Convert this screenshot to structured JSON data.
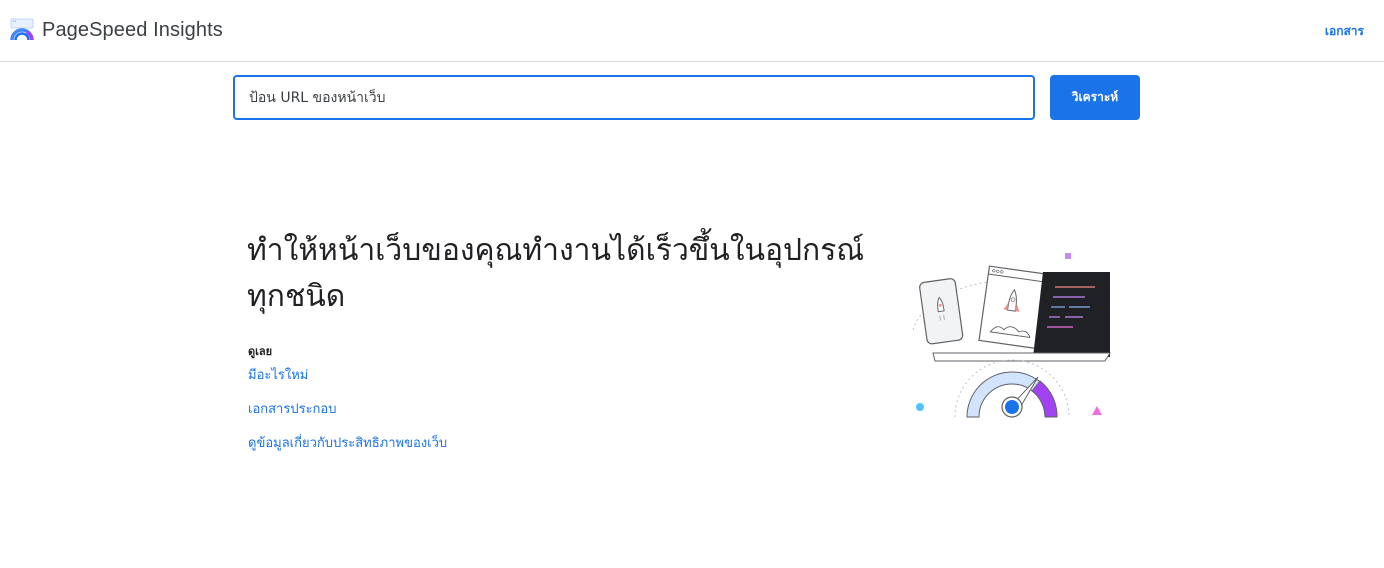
{
  "header": {
    "app_name": "PageSpeed Insights",
    "docs_link": "เอกสาร"
  },
  "search": {
    "placeholder": "ป้อน URL ของหน้าเว็บ",
    "value": "",
    "analyze_label": "วิเคราะห์"
  },
  "hero": {
    "title": "ทำให้หน้าเว็บของคุณทำงานได้เร็วขึ้นในอุปกรณ์ทุกชนิด",
    "see_label": "ดูเลย",
    "links": [
      {
        "label": "มีอะไรใหม่"
      },
      {
        "label": "เอกสารประกอบ"
      },
      {
        "label": "ดูข้อมูลเกี่ยวกับประสิทธิภาพของเว็บ"
      }
    ]
  },
  "colors": {
    "accent": "#1a73e8",
    "border": "#dadce0",
    "text": "#202124"
  },
  "icons": {
    "logo": "pagespeed-gauge-icon",
    "illustration": "speed-devices-illustration"
  }
}
